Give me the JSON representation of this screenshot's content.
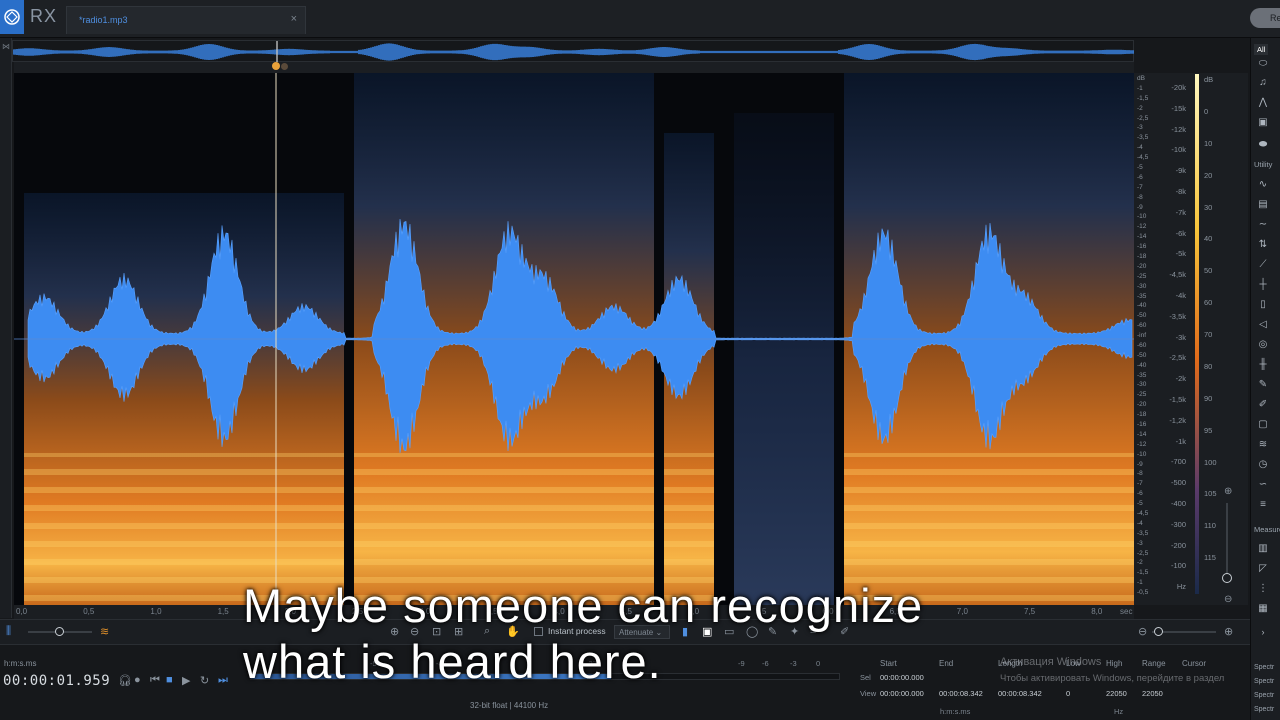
{
  "app": {
    "name": "RX",
    "file_tab": "*radio1.mp3",
    "close_glyph": "×",
    "top_right_button": "Re"
  },
  "spectrogram": {
    "freq_labels": [
      "-20k",
      "-15k",
      "-12k",
      "-10k",
      "-9k",
      "-8k",
      "-7k",
      "-6k",
      "-5k",
      "-4,5k",
      "-4k",
      "-3,5k",
      "-3k",
      "-2,5k",
      "-2k",
      "-1,5k",
      "-1,2k",
      "-1k",
      "-700",
      "-500",
      "-400",
      "-300",
      "-200",
      "-100",
      "Hz"
    ],
    "db_small_labels": [
      "dB",
      "-1",
      "-1,5",
      "-2",
      "-2,5",
      "-3",
      "-3,5",
      "-4",
      "-4,5",
      "-5",
      "-6",
      "-7",
      "-8",
      "-9",
      "-10",
      "-12",
      "-14",
      "-16",
      "-18",
      "-20",
      "-25",
      "-30",
      "-35",
      "-40",
      "-50",
      "-60",
      "-inf",
      "-60",
      "-50",
      "-40",
      "-35",
      "-30",
      "-25",
      "-20",
      "-18",
      "-16",
      "-14",
      "-12",
      "-10",
      "-9",
      "-8",
      "-7",
      "-6",
      "-5",
      "-4,5",
      "-4",
      "-3,5",
      "-3",
      "-2,5",
      "-2",
      "-1,5",
      "-1",
      "-0,5"
    ],
    "db_scale_labels": [
      "dB",
      "0",
      "10",
      "20",
      "30",
      "40",
      "50",
      "60",
      "70",
      "80",
      "90",
      "95",
      "100",
      "105",
      "110",
      "115"
    ],
    "time_labels": [
      "0,0",
      "0,5",
      "1,0",
      "1,5",
      "2,0",
      "2,5",
      "3,0",
      "3,5",
      "4,0",
      "4,5",
      "5,0",
      "5,5",
      "6,0",
      "6,5",
      "7,0",
      "7,5",
      "8,0",
      "sec"
    ],
    "playhead_time_sec": 1.959
  },
  "right_panel": {
    "tab_all": "All",
    "section_utility": "Utility",
    "section_measure": "Measure",
    "spectrum_labels": [
      "Spectr",
      "Spectr",
      "Spectr",
      "Spectr"
    ]
  },
  "toolbar": {
    "instant_process": "Instant process",
    "attenuate": "Attenuate"
  },
  "transport": {
    "time_format": "h:m:s.ms",
    "time_readout": "00:00:01.959",
    "meter_labels": [
      "-48",
      "-54",
      "-45",
      "-27",
      "-9",
      "-6",
      "-3",
      "0"
    ],
    "bit_depth": "32-bit float | 44100 Hz",
    "info_headers": [
      "Start",
      "End",
      "Length",
      "Low",
      "High",
      "Range",
      "Cursor"
    ],
    "sel_label": "Sel",
    "view_label": "View",
    "sel_start": "00:00:00.000",
    "view_start": "00:00:00.000",
    "view_end": "00:00:08.342",
    "view_length": "00:00:08.342",
    "view_low": "0",
    "view_high": "22050",
    "view_range": "22050",
    "units_time": "h:m:s.ms",
    "units_hz": "Hz"
  },
  "windows_activation": {
    "line1": "Активация Windows",
    "line2": "Чтобы активировать Windows, перейдите в раздел"
  },
  "caption": {
    "line1": "Maybe someone can recognize",
    "line2": "what is heard here."
  }
}
